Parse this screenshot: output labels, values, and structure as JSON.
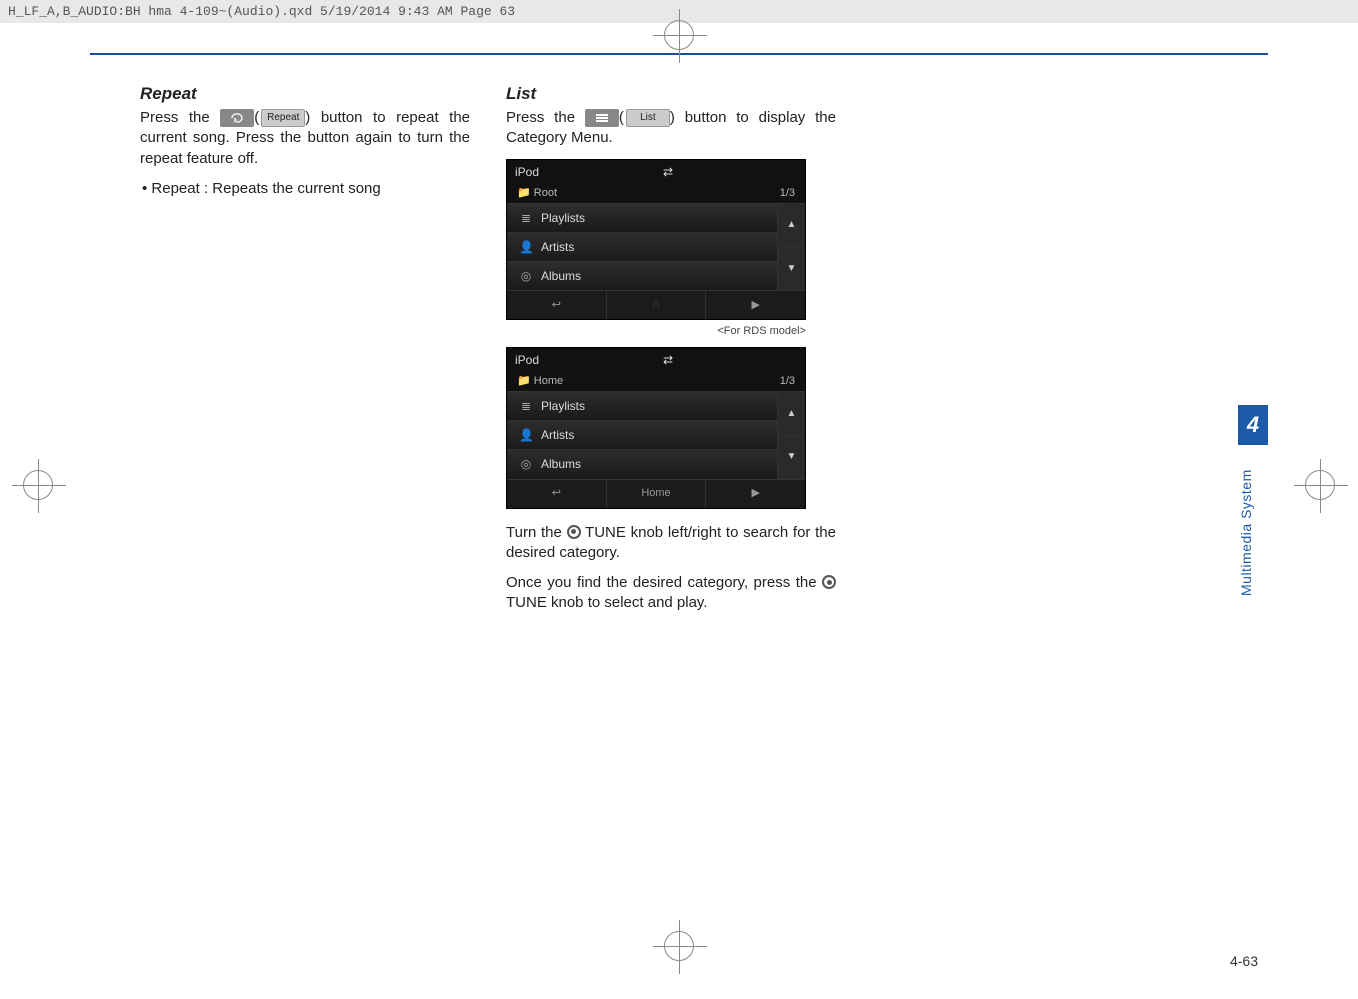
{
  "header_text": "H_LF_A,B_AUDIO:BH hma 4-109~(Audio).qxd  5/19/2014  9:43 AM  Page 63",
  "col1": {
    "heading": "Repeat",
    "p1a": "Press the ",
    "p1b": " button to repeat the current song. Press the button again to turn the repeat feature off.",
    "btn_label": "Repeat",
    "bullet": "• Repeat : Repeats the current song"
  },
  "col2": {
    "heading": "List",
    "p1a": "Press the ",
    "p1b": " button to display the Category Menu.",
    "btn_label": "List",
    "caption1": "<For RDS model>",
    "p2": "Turn the   TUNE knob left/right to search for the desired category.",
    "p3": "Once you find the desired category, press the   TUNE knob to select and play.",
    "tune_a": "Turn the ",
    "tune_b": "TUNE knob left/right to search for the desired category.",
    "tune2_a": "Once you find the desired category, press the ",
    "tune2_b": "TUNE knob to select and play."
  },
  "ss1": {
    "title": "iPod",
    "root": "Root",
    "count": "1/3",
    "i1": "Playlists",
    "i2": "Artists",
    "i3": "Albums"
  },
  "ss2": {
    "title": "iPod",
    "root": "Home",
    "count": "1/3",
    "i1": "Playlists",
    "i2": "Artists",
    "i3": "Albums",
    "home_btn": "Home"
  },
  "sidebar": {
    "num": "4",
    "label": "Multimedia System"
  },
  "page_num": "4-63"
}
